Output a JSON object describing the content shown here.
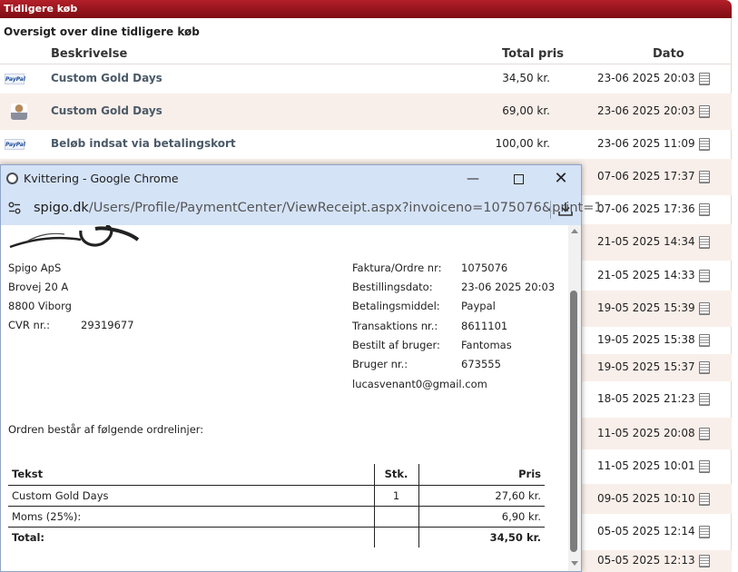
{
  "background": {
    "header_title": "Tidligere køb",
    "subtitle": "Oversigt over dine tidligere køb",
    "columns": {
      "description": "Beskrivelse",
      "total": "Total pris",
      "date": "Dato"
    },
    "rows": [
      {
        "method": "PayPal",
        "icon": "paypal-icon",
        "description": "Custom Gold Days",
        "price": "34,50 kr.",
        "date": "23-06 2025 20:03"
      },
      {
        "method": "",
        "icon": "person-icon",
        "description": "Custom Gold Days",
        "price": "69,00 kr.",
        "date": "23-06 2025 20:03"
      },
      {
        "method": "PayPal",
        "icon": "paypal-icon",
        "description": "Beløb indsat via betalingskort",
        "price": "100,00 kr.",
        "date": "23-06 2025 11:09"
      },
      {
        "date": "07-06 2025 17:37"
      },
      {
        "date": "07-06 2025 17:36"
      },
      {
        "date": "21-05 2025 14:34"
      },
      {
        "date": "21-05 2025 14:33"
      },
      {
        "date": "19-05 2025 15:39"
      },
      {
        "date": "19-05 2025 15:38"
      },
      {
        "date": "19-05 2025 15:37"
      },
      {
        "date": "18-05 2025 21:23"
      },
      {
        "date": "11-05 2025 20:08"
      },
      {
        "date": "11-05 2025 10:01"
      },
      {
        "date": "09-05 2025 10:10"
      },
      {
        "date": "05-05 2025 12:14"
      },
      {
        "date": "05-05 2025 12:13"
      }
    ]
  },
  "popup": {
    "window_title": "Kvittering - Google Chrome",
    "url_host": "spigo.dk",
    "url_path": "/Users/Profile/PaymentCenter/ViewReceipt.aspx?invoiceno=1075076&print=1",
    "company": {
      "name": "Spigo ApS",
      "street": "Brovej 20 A",
      "city": "8800 Viborg",
      "cvr_label": "CVR nr.:",
      "cvr_value": "29319677"
    },
    "order_info": [
      {
        "label": "Faktura/Ordre nr:",
        "value": "1075076"
      },
      {
        "label": "Bestillingsdato:",
        "value": "23-06 2025 20:03"
      },
      {
        "label": "Betalingsmiddel:",
        "value": "Paypal"
      },
      {
        "label": "Transaktions nr.:",
        "value": "8611101"
      },
      {
        "label": "Bestilt af bruger:",
        "value": "Fantomas"
      },
      {
        "label": "Bruger nr.:",
        "value": "673555"
      }
    ],
    "email": "lucasvenant0@gmail.com",
    "lines_intro": "Ordren består af følgende ordrelinjer:",
    "table": {
      "headers": {
        "text": "Tekst",
        "qty": "Stk.",
        "price": "Pris"
      },
      "rows": [
        {
          "text": "Custom Gold Days",
          "qty": "1",
          "price": "27,60 kr."
        },
        {
          "text": "Moms (25%):",
          "qty": "",
          "price": "6,90 kr."
        }
      ],
      "total": {
        "label": "Total:",
        "value": "34,50 kr."
      }
    }
  }
}
